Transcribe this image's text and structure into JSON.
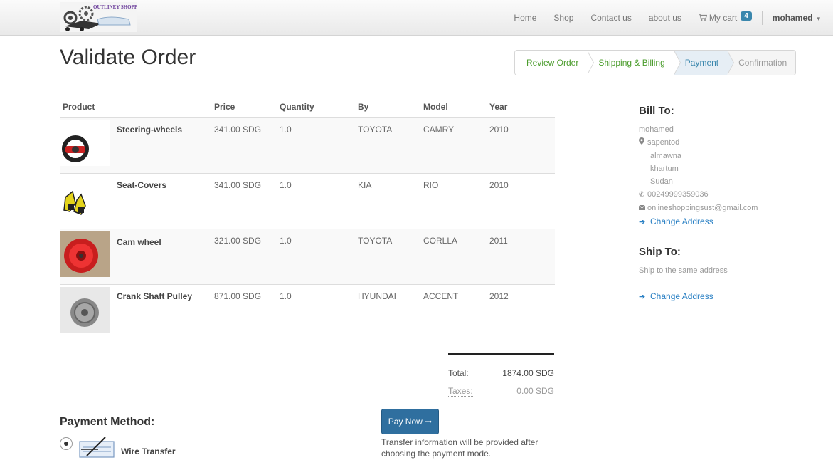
{
  "nav": {
    "logo_text": "OUTLINEY SHOPPING",
    "links": [
      "Home",
      "Shop",
      "Contact us",
      "about us"
    ],
    "cart_label": "My cart",
    "cart_count": "4",
    "user": "mohamed"
  },
  "page": {
    "title": "Validate Order"
  },
  "steps": [
    "Review Order",
    "Shipping & Billing",
    "Payment",
    "Confirmation"
  ],
  "table": {
    "headers": [
      "Product",
      "Price",
      "Quantity",
      "By",
      "Model",
      "Year"
    ],
    "rows": [
      {
        "product": "Steering-wheels",
        "price": "341.00 SDG",
        "quantity": "1.0",
        "by": "TOYOTA",
        "model": "CAMRY",
        "year": "2010",
        "image": "steering-wheel-icon"
      },
      {
        "product": "Seat-Covers",
        "price": "341.00 SDG",
        "quantity": "1.0",
        "by": "KIA",
        "model": "RIO",
        "year": "2010",
        "image": "seat-cover-icon"
      },
      {
        "product": "Cam wheel",
        "price": "321.00 SDG",
        "quantity": "1.0",
        "by": "TOYOTA",
        "model": "CORLLA",
        "year": "2011",
        "image": "cam-wheel-icon"
      },
      {
        "product": "Crank Shaft Pulley",
        "price": "871.00 SDG",
        "quantity": "1.0",
        "by": "HYUNDAI",
        "model": "ACCENT",
        "year": "2012",
        "image": "pulley-icon"
      }
    ]
  },
  "totals": {
    "total_label": "Total:",
    "total_value": "1874.00 SDG",
    "taxes_label": "Taxes:",
    "taxes_value": "0.00 SDG"
  },
  "payment": {
    "heading": "Payment Method:",
    "method": "Wire Transfer",
    "pay_button": "Pay Now ➞",
    "note": "Transfer information will be provided after choosing the payment mode."
  },
  "bill_to": {
    "heading": "Bill To:",
    "name": "mohamed",
    "street": "sapentod",
    "area": "almawna",
    "city": "khartum",
    "country": "Sudan",
    "phone": "00249999359036",
    "email": "onlineshoppingsust@gmail.com",
    "change_link": "Change Address"
  },
  "ship_to": {
    "heading": "Ship To:",
    "note": "Ship to the same address",
    "change_link": "Change Address"
  },
  "colors": {
    "accent": "#2a80c4",
    "button": "#2f6f9f",
    "step_done": "#4c9d2e",
    "badge": "#3a87ad"
  }
}
